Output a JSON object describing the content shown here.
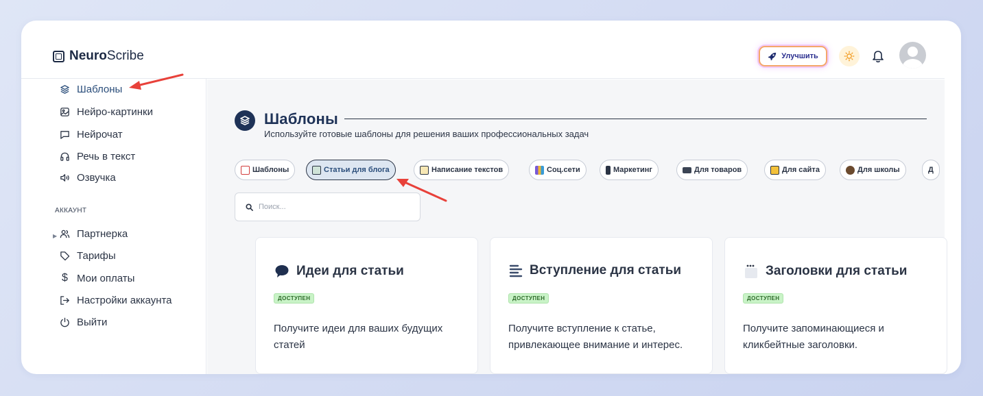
{
  "brand": {
    "bold": "Neuro",
    "light": "Scribe"
  },
  "header": {
    "upgrade_label": "Улучшить"
  },
  "sidebar": {
    "items": [
      {
        "label": "Шаблоны",
        "icon": "layers-icon"
      },
      {
        "label": "Нейро-картинки",
        "icon": "image-icon"
      },
      {
        "label": "Нейрочат",
        "icon": "chat-icon"
      },
      {
        "label": "Речь в текст",
        "icon": "headphones-icon"
      },
      {
        "label": "Озвучка",
        "icon": "speaker-icon"
      }
    ],
    "section_label": "АККАУНТ",
    "account_items": [
      {
        "label": "Партнерка",
        "icon": "users-icon"
      },
      {
        "label": "Тарифы",
        "icon": "tag-icon"
      },
      {
        "label": "Мои оплаты",
        "icon": "dollar-icon"
      },
      {
        "label": "Настройки аккаунта",
        "icon": "login-icon"
      },
      {
        "label": "Выйти",
        "icon": "power-icon"
      }
    ]
  },
  "main": {
    "title": "Шаблоны",
    "subtitle": "Используйте готовые шаблоны для решения ваших профессиональных задач",
    "chips": [
      {
        "label": "Шаблоны",
        "active": false
      },
      {
        "label": "Статьи для блога",
        "active": true
      },
      {
        "label": "Написание текстов",
        "active": false
      },
      {
        "label": "Соц.сети",
        "active": false
      },
      {
        "label": "Маркетинг",
        "active": false
      },
      {
        "label": "Для товаров",
        "active": false
      },
      {
        "label": "Для сайта",
        "active": false
      },
      {
        "label": "Для школы",
        "active": false
      },
      {
        "label": "Д",
        "active": false
      }
    ],
    "search_placeholder": "Поиск...",
    "cards": [
      {
        "title": "Идеи для статьи",
        "badge": "ДОСТУПЕН",
        "description": "Получите идеи для ваших будущих статей"
      },
      {
        "title": "Вступление для статьи",
        "badge": "ДОСТУПЕН",
        "description": "Получите вступление к статье, привлекающее внимание и интерес."
      },
      {
        "title": "Заголовки для статьи",
        "badge": "ДОСТУПЕН",
        "description": "Получите запоминающиеся и кликбейтные заголовки."
      }
    ]
  },
  "colors": {
    "accent": "#1e3257",
    "badge_bg": "#c9f3c7",
    "annotation_arrow": "#e8413a"
  }
}
